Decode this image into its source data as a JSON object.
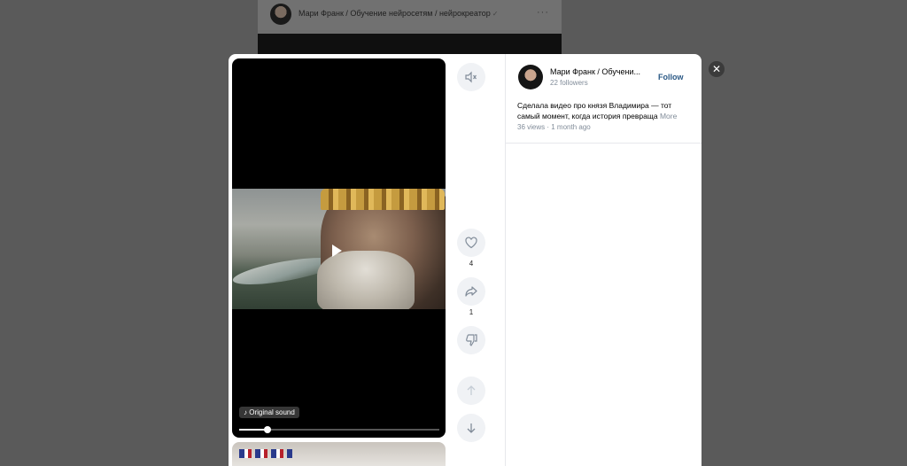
{
  "background": {
    "post_title": "Мари Франк / Обучение нейросетям / нейрокреатор",
    "more_dots": "···"
  },
  "player": {
    "sound_label": "♪ Original sound",
    "progress": 0.14
  },
  "actions": {
    "likes": "4",
    "shares": "1"
  },
  "info": {
    "author": "Мари Франк / Обучени...",
    "followers": "22 followers",
    "follow_label": "Follow",
    "description": "Сделала видео про князя Владимира — тот самый момент, когда история превраща",
    "more_label": "More",
    "meta": "36 views · 1 month ago"
  },
  "close_label": "✕"
}
